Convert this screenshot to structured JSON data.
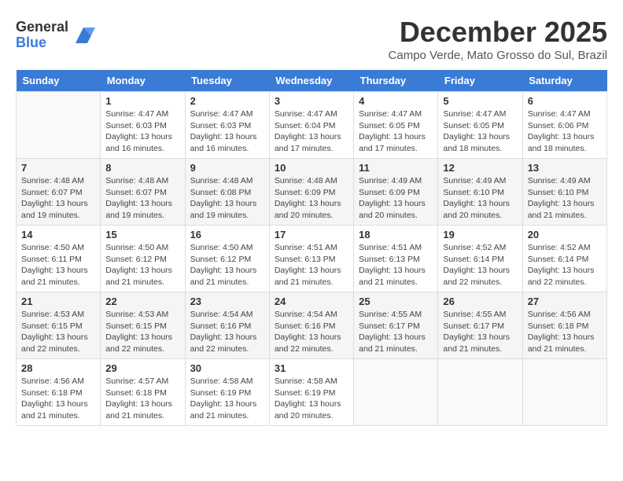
{
  "app": {
    "logo_general": "General",
    "logo_blue": "Blue"
  },
  "calendar": {
    "month_title": "December 2025",
    "subtitle": "Campo Verde, Mato Grosso do Sul, Brazil",
    "headers": [
      "Sunday",
      "Monday",
      "Tuesday",
      "Wednesday",
      "Thursday",
      "Friday",
      "Saturday"
    ],
    "weeks": [
      [
        {
          "day": "",
          "sunrise": "",
          "sunset": "",
          "daylight": ""
        },
        {
          "day": "1",
          "sunrise": "Sunrise: 4:47 AM",
          "sunset": "Sunset: 6:03 PM",
          "daylight": "Daylight: 13 hours and 16 minutes."
        },
        {
          "day": "2",
          "sunrise": "Sunrise: 4:47 AM",
          "sunset": "Sunset: 6:03 PM",
          "daylight": "Daylight: 13 hours and 16 minutes."
        },
        {
          "day": "3",
          "sunrise": "Sunrise: 4:47 AM",
          "sunset": "Sunset: 6:04 PM",
          "daylight": "Daylight: 13 hours and 17 minutes."
        },
        {
          "day": "4",
          "sunrise": "Sunrise: 4:47 AM",
          "sunset": "Sunset: 6:05 PM",
          "daylight": "Daylight: 13 hours and 17 minutes."
        },
        {
          "day": "5",
          "sunrise": "Sunrise: 4:47 AM",
          "sunset": "Sunset: 6:05 PM",
          "daylight": "Daylight: 13 hours and 18 minutes."
        },
        {
          "day": "6",
          "sunrise": "Sunrise: 4:47 AM",
          "sunset": "Sunset: 6:06 PM",
          "daylight": "Daylight: 13 hours and 18 minutes."
        }
      ],
      [
        {
          "day": "7",
          "sunrise": "Sunrise: 4:48 AM",
          "sunset": "Sunset: 6:07 PM",
          "daylight": "Daylight: 13 hours and 19 minutes."
        },
        {
          "day": "8",
          "sunrise": "Sunrise: 4:48 AM",
          "sunset": "Sunset: 6:07 PM",
          "daylight": "Daylight: 13 hours and 19 minutes."
        },
        {
          "day": "9",
          "sunrise": "Sunrise: 4:48 AM",
          "sunset": "Sunset: 6:08 PM",
          "daylight": "Daylight: 13 hours and 19 minutes."
        },
        {
          "day": "10",
          "sunrise": "Sunrise: 4:48 AM",
          "sunset": "Sunset: 6:09 PM",
          "daylight": "Daylight: 13 hours and 20 minutes."
        },
        {
          "day": "11",
          "sunrise": "Sunrise: 4:49 AM",
          "sunset": "Sunset: 6:09 PM",
          "daylight": "Daylight: 13 hours and 20 minutes."
        },
        {
          "day": "12",
          "sunrise": "Sunrise: 4:49 AM",
          "sunset": "Sunset: 6:10 PM",
          "daylight": "Daylight: 13 hours and 20 minutes."
        },
        {
          "day": "13",
          "sunrise": "Sunrise: 4:49 AM",
          "sunset": "Sunset: 6:10 PM",
          "daylight": "Daylight: 13 hours and 21 minutes."
        }
      ],
      [
        {
          "day": "14",
          "sunrise": "Sunrise: 4:50 AM",
          "sunset": "Sunset: 6:11 PM",
          "daylight": "Daylight: 13 hours and 21 minutes."
        },
        {
          "day": "15",
          "sunrise": "Sunrise: 4:50 AM",
          "sunset": "Sunset: 6:12 PM",
          "daylight": "Daylight: 13 hours and 21 minutes."
        },
        {
          "day": "16",
          "sunrise": "Sunrise: 4:50 AM",
          "sunset": "Sunset: 6:12 PM",
          "daylight": "Daylight: 13 hours and 21 minutes."
        },
        {
          "day": "17",
          "sunrise": "Sunrise: 4:51 AM",
          "sunset": "Sunset: 6:13 PM",
          "daylight": "Daylight: 13 hours and 21 minutes."
        },
        {
          "day": "18",
          "sunrise": "Sunrise: 4:51 AM",
          "sunset": "Sunset: 6:13 PM",
          "daylight": "Daylight: 13 hours and 21 minutes."
        },
        {
          "day": "19",
          "sunrise": "Sunrise: 4:52 AM",
          "sunset": "Sunset: 6:14 PM",
          "daylight": "Daylight: 13 hours and 22 minutes."
        },
        {
          "day": "20",
          "sunrise": "Sunrise: 4:52 AM",
          "sunset": "Sunset: 6:14 PM",
          "daylight": "Daylight: 13 hours and 22 minutes."
        }
      ],
      [
        {
          "day": "21",
          "sunrise": "Sunrise: 4:53 AM",
          "sunset": "Sunset: 6:15 PM",
          "daylight": "Daylight: 13 hours and 22 minutes."
        },
        {
          "day": "22",
          "sunrise": "Sunrise: 4:53 AM",
          "sunset": "Sunset: 6:15 PM",
          "daylight": "Daylight: 13 hours and 22 minutes."
        },
        {
          "day": "23",
          "sunrise": "Sunrise: 4:54 AM",
          "sunset": "Sunset: 6:16 PM",
          "daylight": "Daylight: 13 hours and 22 minutes."
        },
        {
          "day": "24",
          "sunrise": "Sunrise: 4:54 AM",
          "sunset": "Sunset: 6:16 PM",
          "daylight": "Daylight: 13 hours and 22 minutes."
        },
        {
          "day": "25",
          "sunrise": "Sunrise: 4:55 AM",
          "sunset": "Sunset: 6:17 PM",
          "daylight": "Daylight: 13 hours and 21 minutes."
        },
        {
          "day": "26",
          "sunrise": "Sunrise: 4:55 AM",
          "sunset": "Sunset: 6:17 PM",
          "daylight": "Daylight: 13 hours and 21 minutes."
        },
        {
          "day": "27",
          "sunrise": "Sunrise: 4:56 AM",
          "sunset": "Sunset: 6:18 PM",
          "daylight": "Daylight: 13 hours and 21 minutes."
        }
      ],
      [
        {
          "day": "28",
          "sunrise": "Sunrise: 4:56 AM",
          "sunset": "Sunset: 6:18 PM",
          "daylight": "Daylight: 13 hours and 21 minutes."
        },
        {
          "day": "29",
          "sunrise": "Sunrise: 4:57 AM",
          "sunset": "Sunset: 6:18 PM",
          "daylight": "Daylight: 13 hours and 21 minutes."
        },
        {
          "day": "30",
          "sunrise": "Sunrise: 4:58 AM",
          "sunset": "Sunset: 6:19 PM",
          "daylight": "Daylight: 13 hours and 21 minutes."
        },
        {
          "day": "31",
          "sunrise": "Sunrise: 4:58 AM",
          "sunset": "Sunset: 6:19 PM",
          "daylight": "Daylight: 13 hours and 20 minutes."
        },
        {
          "day": "",
          "sunrise": "",
          "sunset": "",
          "daylight": ""
        },
        {
          "day": "",
          "sunrise": "",
          "sunset": "",
          "daylight": ""
        },
        {
          "day": "",
          "sunrise": "",
          "sunset": "",
          "daylight": ""
        }
      ]
    ]
  }
}
